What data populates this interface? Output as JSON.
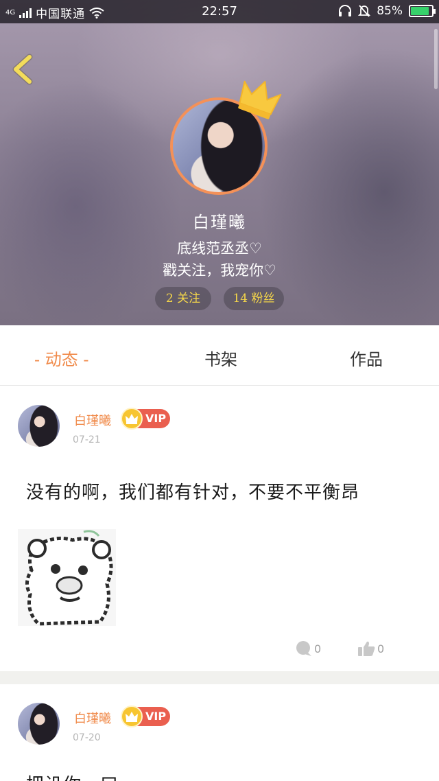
{
  "status_bar": {
    "network": "4G",
    "carrier": "中国联通",
    "time": "22:57",
    "battery": "85%",
    "battery_level": 0.85
  },
  "profile": {
    "name": "白瑾曦",
    "bio_line_1": "底线范丞丞♡",
    "bio_line_2": "戳关注，我宠你♡",
    "following": "2 关注",
    "followers": "14 粉丝"
  },
  "tabs": {
    "feed": "- 动态 -",
    "shelf": "书架",
    "works": "作品"
  },
  "posts": [
    {
      "author": "白瑾曦",
      "vip": "VIP",
      "date": "07-21",
      "text": "没有的啊，我们都有针对，不要不平衡昂",
      "comments": "0",
      "likes": "0"
    },
    {
      "author": "白瑾曦",
      "vip": "VIP",
      "date": "07-20",
      "text": "把讥你一口"
    }
  ],
  "icons": {
    "back": "chevron-left-icon",
    "crown": "crown-icon",
    "comment": "comment-bubble-icon",
    "like": "thumbs-up-icon"
  },
  "colors": {
    "accent": "#f08a4a",
    "stats": "#f5d64a",
    "vip": "#ea5f4f",
    "back_arrow": "#f3dc5a"
  }
}
